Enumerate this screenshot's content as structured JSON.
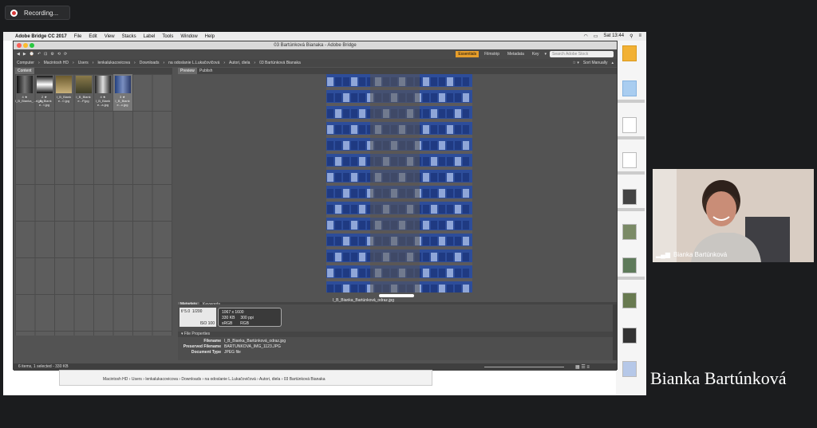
{
  "recording": {
    "label": "Recording..."
  },
  "mac_menubar": {
    "app": "Adobe Bridge CC 2017",
    "menus": [
      "File",
      "Edit",
      "View",
      "Stacks",
      "Label",
      "Tools",
      "Window",
      "Help"
    ],
    "clock": "Sat 13:44"
  },
  "window": {
    "title": "03 Bartúnková Bianaka - Adobe Bridge",
    "workspaces": [
      "Essentials",
      "Filmstrip",
      "Metadata",
      "Key"
    ],
    "active_workspace": "Essentials",
    "search_placeholder": "Search Adobe Stock",
    "sort_label": "Sort Manually"
  },
  "path": [
    "Computer",
    "Macintosh HD",
    "Users",
    "lenkalukacovicova",
    "Downloads",
    "na odoslanie L.Lukačovičová",
    "Autori, diela",
    "03 Bartúnková Bianaka"
  ],
  "content_panel": {
    "tab": "Content",
    "thumbs": [
      {
        "stars": "4 ★",
        "name": "I_B_Bianka_...n.jpg"
      },
      {
        "stars": "2 ★",
        "name": "I_B_Biank e...t.jpg"
      },
      {
        "stars": "",
        "name": "I_B_Biank e...0.jpg"
      },
      {
        "stars": "",
        "name": "I_B_Biank e...P.jpg"
      },
      {
        "stars": "4 ★",
        "name": "I_B_Biank e...a.jpg"
      },
      {
        "stars": "3 ★",
        "name": "I_B_Biank e...c.jpg"
      }
    ]
  },
  "preview_panel": {
    "tabs": [
      "Preview",
      "Publish"
    ],
    "caption": "I_B_Bianka_Bartúnková_odraz.jpg"
  },
  "metadata_panel": {
    "tabs": [
      "Metadata",
      "Keywords"
    ],
    "placard": {
      "fstop": "f/ 5.0",
      "shutter": "1/200",
      "dims": "1067 x 1600",
      "size": "330 KB",
      "dpi": "300 ppi",
      "color": "sRGB",
      "mode": "RGB",
      "iso": "ISO 100"
    },
    "section": "File Properties",
    "fields": [
      {
        "label": "Filename",
        "value": "I_B_Bianka_Bartúnková_odraz.jpg"
      },
      {
        "label": "Preserved Filename",
        "value": "BARTUNKOVA_IMG_1123.JPG"
      },
      {
        "label": "Document Type",
        "value": "JPEG file"
      }
    ]
  },
  "status": "6 items, 1 selected - 330 KB",
  "lower_path": "Macintosh HD › Users › lenkalukacovicova › Downloads › na odoslanie L.Lukačovičová › Autori, diela › 03 Bartúnková Bianaka",
  "participant": {
    "name": "Bianka Bartúnková"
  },
  "speaker_caption": "Bianka Bartúnková"
}
